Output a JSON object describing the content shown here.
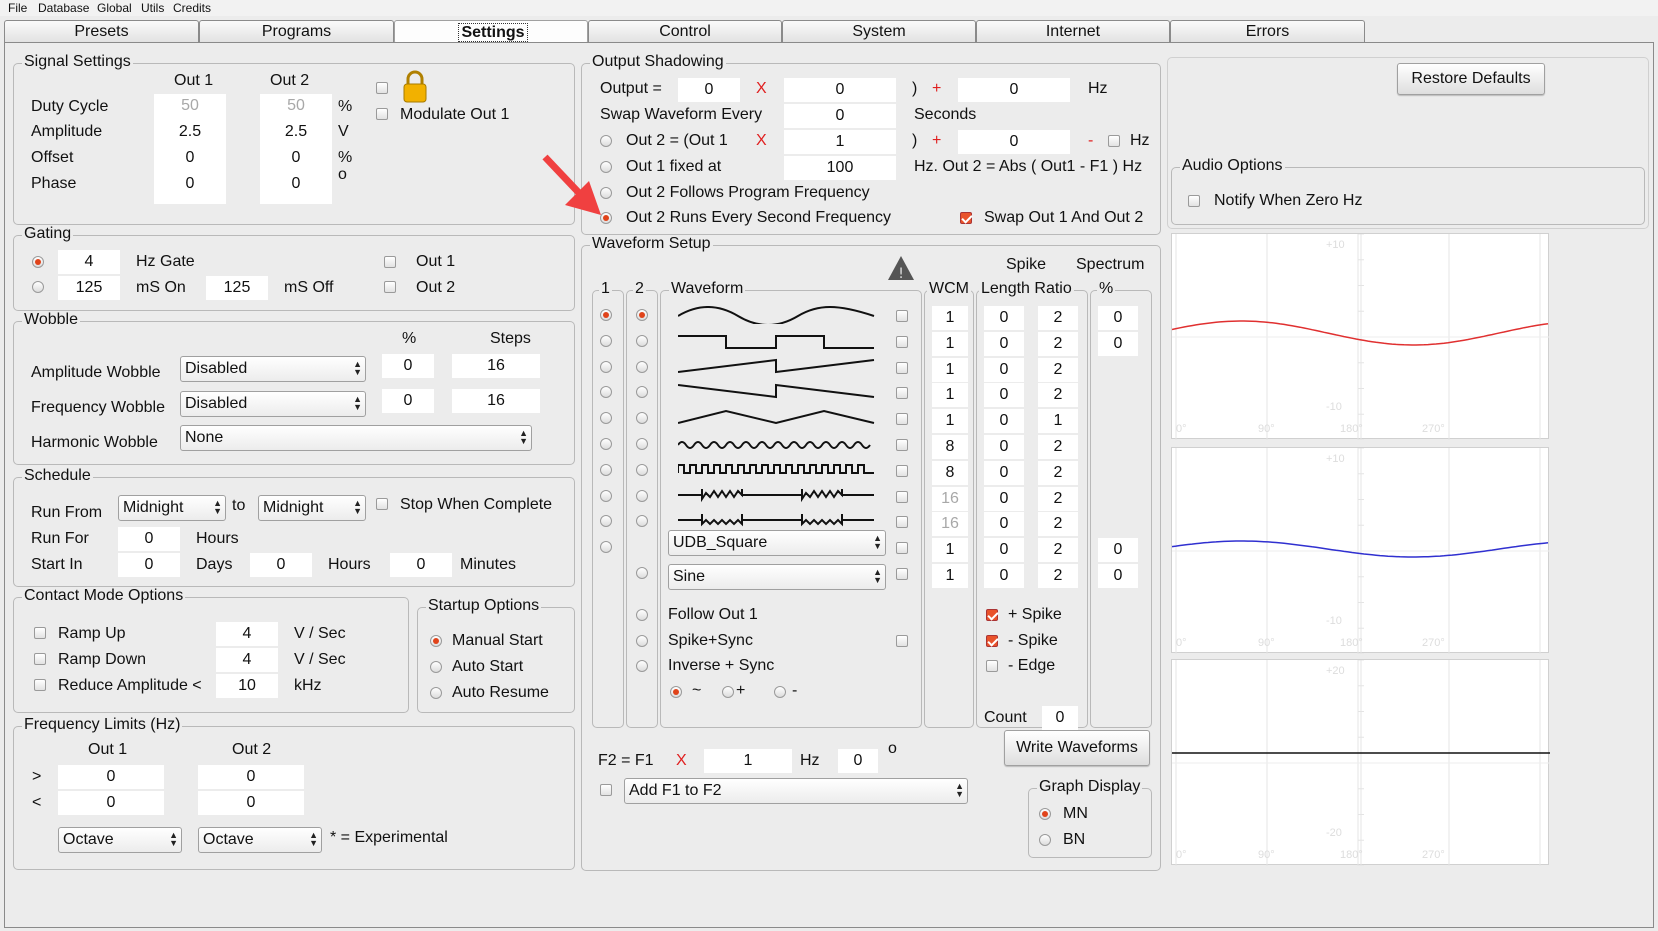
{
  "menu": [
    "File",
    "Database",
    "Global",
    "Utils",
    "Credits"
  ],
  "tabs": [
    "Presets",
    "Programs",
    "Settings",
    "Control",
    "System",
    "Internet",
    "Errors"
  ],
  "selected_tab": "Settings",
  "signal": {
    "title": "Signal Settings",
    "out1": "Out 1",
    "out2": "Out 2",
    "rows": [
      {
        "label": "Duty Cycle",
        "v1": "50",
        "v2": "50",
        "unit": "%"
      },
      {
        "label": "Amplitude",
        "v1": "2.5",
        "v2": "2.5",
        "unit": "V"
      },
      {
        "label": "Offset",
        "v1": "0",
        "v2": "0",
        "unit": "%"
      },
      {
        "label": "Phase",
        "v1": "0",
        "v2": "0",
        "unit": "o"
      }
    ],
    "modulate": "Modulate Out 1"
  },
  "gating": {
    "title": "Gating",
    "hz": "4",
    "hz_label": "Hz Gate",
    "on": "125",
    "on_label": "mS On",
    "off": "125",
    "off_label": "mS Off",
    "out1": "Out 1",
    "out2": "Out 2"
  },
  "wobble": {
    "title": "Wobble",
    "pct": "%",
    "steps": "Steps",
    "rows": [
      {
        "label": "Amplitude Wobble",
        "sel": "Disabled",
        "pct": "0",
        "steps": "16"
      },
      {
        "label": "Frequency Wobble",
        "sel": "Disabled",
        "pct": "0",
        "steps": "16"
      }
    ],
    "harm_label": "Harmonic Wobble",
    "harm_sel": "None"
  },
  "schedule": {
    "title": "Schedule",
    "run_from": "Run From",
    "from": "Midnight",
    "to": "to",
    "to_val": "Midnight",
    "stop": "Stop When Complete",
    "run_for": "Run For",
    "run_for_v": "0",
    "hours": "Hours",
    "start_in": "Start In",
    "start_v": "0",
    "days": "Days",
    "days_v": "0",
    "hours2": "Hours",
    "min_v": "0",
    "minutes": "Minutes"
  },
  "contact": {
    "title": "Contact Mode Options",
    "rows": [
      {
        "label": "Ramp Up",
        "v": "4",
        "unit": "V / Sec"
      },
      {
        "label": "Ramp Down",
        "v": "4",
        "unit": "V / Sec"
      },
      {
        "label": "Reduce Amplitude <",
        "v": "10",
        "unit": "kHz"
      }
    ]
  },
  "startup": {
    "title": "Startup Options",
    "opts": [
      "Manual Start",
      "Auto Start",
      "Auto Resume"
    ]
  },
  "freq": {
    "title": "Frequency Limits (Hz)",
    "out1": "Out 1",
    "out2": "Out 2",
    "gt": ">",
    "lt": "<",
    "a": "0",
    "b": "0",
    "c": "0",
    "d": "0",
    "oct1": "Octave",
    "oct2": "Octave",
    "exp": "* = Experimental"
  },
  "shadow": {
    "title": "Output Shadowing",
    "output": "Output =",
    "o1": "0",
    "x": "X",
    "o2": "0",
    "paren": ")",
    "plus": "+",
    "o3": "0",
    "hz": "Hz",
    "swap": "Swap Waveform Every",
    "swap_v": "0",
    "seconds": "Seconds",
    "out2eq": "Out 2 = (Out 1",
    "m1": "1",
    "m2": "0",
    "minus": "-",
    "hz2": "Hz",
    "fixed": "Out 1 fixed at",
    "fixed_v": "100",
    "abs": "Hz. Out 2 = Abs ( Out1 - F1 ) Hz",
    "follows": "Out 2 Follows Program Frequency",
    "runs": "Out 2 Runs Every Second Frequency",
    "swapout": "Swap Out 1 And Out 2"
  },
  "wave": {
    "title": "Waveform Setup",
    "c1": "1",
    "c2": "2",
    "waveform": "Waveform",
    "wcm": "WCM",
    "spike": "Spike",
    "length_ratio": "Length Ratio",
    "spectrum": "Spectrum",
    "pct": "%",
    "wcm_vals": [
      "1",
      "1",
      "1",
      "1",
      "1",
      "8",
      "8",
      "16",
      "16",
      "1",
      "1"
    ],
    "len_vals": [
      "0",
      "0",
      "0",
      "0",
      "0",
      "0",
      "0",
      "0",
      "0",
      "0",
      "0"
    ],
    "ratio_vals": [
      "2",
      "2",
      "2",
      "2",
      "1",
      "2",
      "2",
      "2",
      "2",
      "2",
      "2"
    ],
    "spec_vals": [
      "0",
      "0",
      "",
      "",
      "",
      "",
      "",
      "",
      "",
      "0",
      "0"
    ],
    "sel1": "UDB_Square",
    "sel2": "Sine",
    "follow": "Follow Out 1",
    "spikesync": "Spike+Sync",
    "inverse": "Inverse + Sync",
    "tilde": "~",
    "plus": "+",
    "minus": "-",
    "pspike": "+ Spike",
    "mspike": "- Spike",
    "medge": "- Edge",
    "count": "Count",
    "count_v": "0",
    "f2": "F2 = F1",
    "x": "X",
    "f2m": "1",
    "hz": "Hz",
    "f2o": "0",
    "deg": "o",
    "add": "Add F1 to F2",
    "write": "Write Waveforms",
    "graph": "Graph Display",
    "mn": "MN",
    "bn": "BN"
  },
  "restore": "Restore Defaults",
  "audio": {
    "title": "Audio Options",
    "notify": "Notify When Zero Hz"
  },
  "plots": {
    "ticks": [
      "+10",
      "-10",
      "+10",
      "-10",
      "+20",
      "-20"
    ],
    "x": [
      "0°",
      "90°",
      "180°",
      "270°"
    ],
    "colors": [
      "#e03030",
      "#3030d0",
      "#111111"
    ]
  }
}
